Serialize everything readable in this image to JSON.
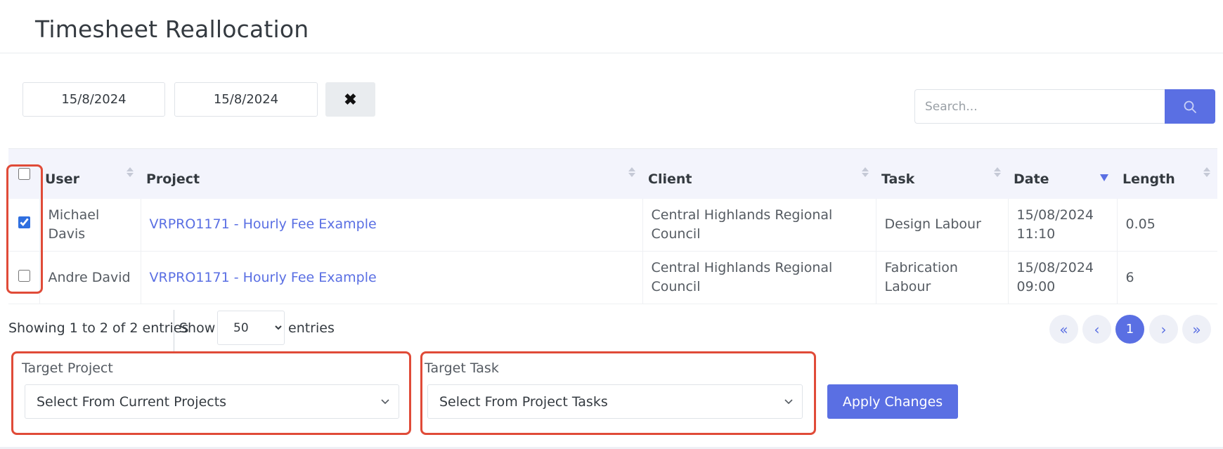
{
  "page": {
    "title": "Timesheet Reallocation"
  },
  "filters": {
    "date_from": "15/8/2024",
    "date_to": "15/8/2024",
    "clear_label": "✖",
    "search_placeholder": "Search..."
  },
  "table": {
    "columns": [
      "User",
      "Project",
      "Client",
      "Task",
      "Date",
      "Length"
    ],
    "rows": [
      {
        "checked": true,
        "user": "Michael Davis",
        "project": "VRPRO1171 - Hourly Fee Example",
        "client_line1": "Central Highlands Regional",
        "client_line2": "Council",
        "task_line1": "Design Labour",
        "task_line2": "",
        "date_line1": "15/08/2024",
        "date_line2": "11:10",
        "length": "0.05"
      },
      {
        "checked": false,
        "user": "Andre David",
        "project": "VRPRO1171 - Hourly Fee Example",
        "client_line1": "Central Highlands Regional",
        "client_line2": "Council",
        "task_line1": "Fabrication",
        "task_line2": "Labour",
        "date_line1": "15/08/2024",
        "date_line2": "09:00",
        "length": "6"
      }
    ]
  },
  "footer": {
    "info": "Showing 1 to 2 of 2 entries",
    "show_label": "Show",
    "page_length": "50",
    "entries_label": "entries",
    "pagination": {
      "first": "«",
      "prev": "‹",
      "current": "1",
      "next": "›",
      "last": "»"
    }
  },
  "reallocate": {
    "target_project_label": "Target Project",
    "target_project_placeholder": "Select From Current Projects",
    "target_task_label": "Target Task",
    "target_task_placeholder": "Select From Project Tasks",
    "apply_label": "Apply Changes"
  },
  "colors": {
    "accent": "#5a6fe3",
    "highlight": "#e04b38",
    "header_bg": "#f3f4fc"
  }
}
